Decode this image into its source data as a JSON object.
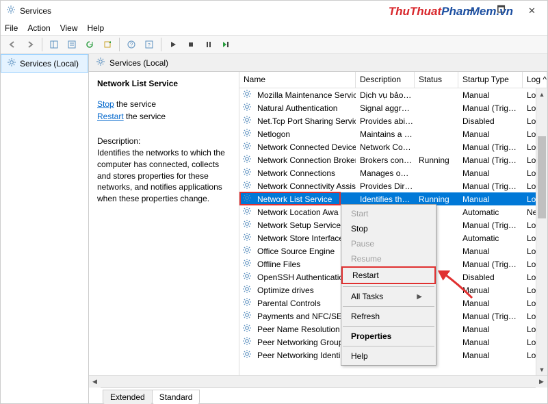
{
  "window": {
    "title": "Services"
  },
  "menu": {
    "file": "File",
    "action": "Action",
    "view": "View",
    "help": "Help"
  },
  "watermark": {
    "part1": "ThuThuat",
    "part2": "PhanMem",
    "part3": ".vn"
  },
  "nav": {
    "item": "Services (Local)"
  },
  "main_header": "Services (Local)",
  "desc": {
    "name": "Network List Service",
    "stop_link": "Stop",
    "stop_rest": " the service",
    "restart_link": "Restart",
    "restart_rest": " the service",
    "label": "Description:",
    "body": "Identifies the networks to which the computer has connected, collects and stores properties for these networks, and notifies applications when these properties change."
  },
  "columns": {
    "name": "Name",
    "desc": "Description",
    "status": "Status",
    "startup": "Startup Type",
    "log": "Log ^"
  },
  "services": [
    {
      "name": "Mozilla Maintenance Service",
      "desc": "Dịch vụ bảo…",
      "status": "",
      "startup": "Manual",
      "log": "Loc"
    },
    {
      "name": "Natural Authentication",
      "desc": "Signal aggr…",
      "status": "",
      "startup": "Manual (Trig…",
      "log": "Loc"
    },
    {
      "name": "Net.Tcp Port Sharing Service",
      "desc": "Provides abi…",
      "status": "",
      "startup": "Disabled",
      "log": "Loc"
    },
    {
      "name": "Netlogon",
      "desc": "Maintains a …",
      "status": "",
      "startup": "Manual",
      "log": "Loc"
    },
    {
      "name": "Network Connected Device…",
      "desc": "Network Co…",
      "status": "",
      "startup": "Manual (Trig…",
      "log": "Loc"
    },
    {
      "name": "Network Connection Broker",
      "desc": "Brokers con…",
      "status": "Running",
      "startup": "Manual (Trig…",
      "log": "Loc"
    },
    {
      "name": "Network Connections",
      "desc": "Manages o…",
      "status": "",
      "startup": "Manual",
      "log": "Loc"
    },
    {
      "name": "Network Connectivity Assis…",
      "desc": "Provides Dir…",
      "status": "",
      "startup": "Manual (Trig…",
      "log": "Loc"
    },
    {
      "name": "Network List Service",
      "desc": "Identifies th…",
      "status": "Running",
      "startup": "Manual",
      "log": "Loca",
      "selected": true
    },
    {
      "name": "Network Location Awa",
      "desc": "",
      "status": "ning",
      "startup": "Automatic",
      "log": "Net"
    },
    {
      "name": "Network Setup Service",
      "desc": "",
      "status": "",
      "startup": "Manual (Trig…",
      "log": "Loc"
    },
    {
      "name": "Network Store Interface",
      "desc": "",
      "status": "ning",
      "startup": "Automatic",
      "log": "Loc"
    },
    {
      "name": "Office  Source Engine",
      "desc": "",
      "status": "",
      "startup": "Manual",
      "log": "Loc"
    },
    {
      "name": "Offline Files",
      "desc": "",
      "status": "",
      "startup": "Manual (Trig…",
      "log": "Loc"
    },
    {
      "name": "OpenSSH Authenticatio",
      "desc": "",
      "status": "",
      "startup": "Disabled",
      "log": "Loc"
    },
    {
      "name": "Optimize drives",
      "desc": "",
      "status": "",
      "startup": "Manual",
      "log": "Loc"
    },
    {
      "name": "Parental Controls",
      "desc": "",
      "status": "",
      "startup": "Manual",
      "log": "Loc"
    },
    {
      "name": "Payments and NFC/SE",
      "desc": "",
      "status": "",
      "startup": "Manual (Trig…",
      "log": "Loc"
    },
    {
      "name": "Peer Name Resolution",
      "desc": "",
      "status": "",
      "startup": "Manual",
      "log": "Loc"
    },
    {
      "name": "Peer Networking Group",
      "desc": "",
      "status": "",
      "startup": "Manual",
      "log": "Loc"
    },
    {
      "name": "Peer Networking Identi",
      "desc": "",
      "status": "",
      "startup": "Manual",
      "log": "Loc"
    }
  ],
  "context_menu": {
    "start": "Start",
    "stop": "Stop",
    "pause": "Pause",
    "resume": "Resume",
    "restart": "Restart",
    "all_tasks": "All Tasks",
    "refresh": "Refresh",
    "properties": "Properties",
    "help": "Help"
  },
  "tabs": {
    "extended": "Extended",
    "standard": "Standard"
  }
}
